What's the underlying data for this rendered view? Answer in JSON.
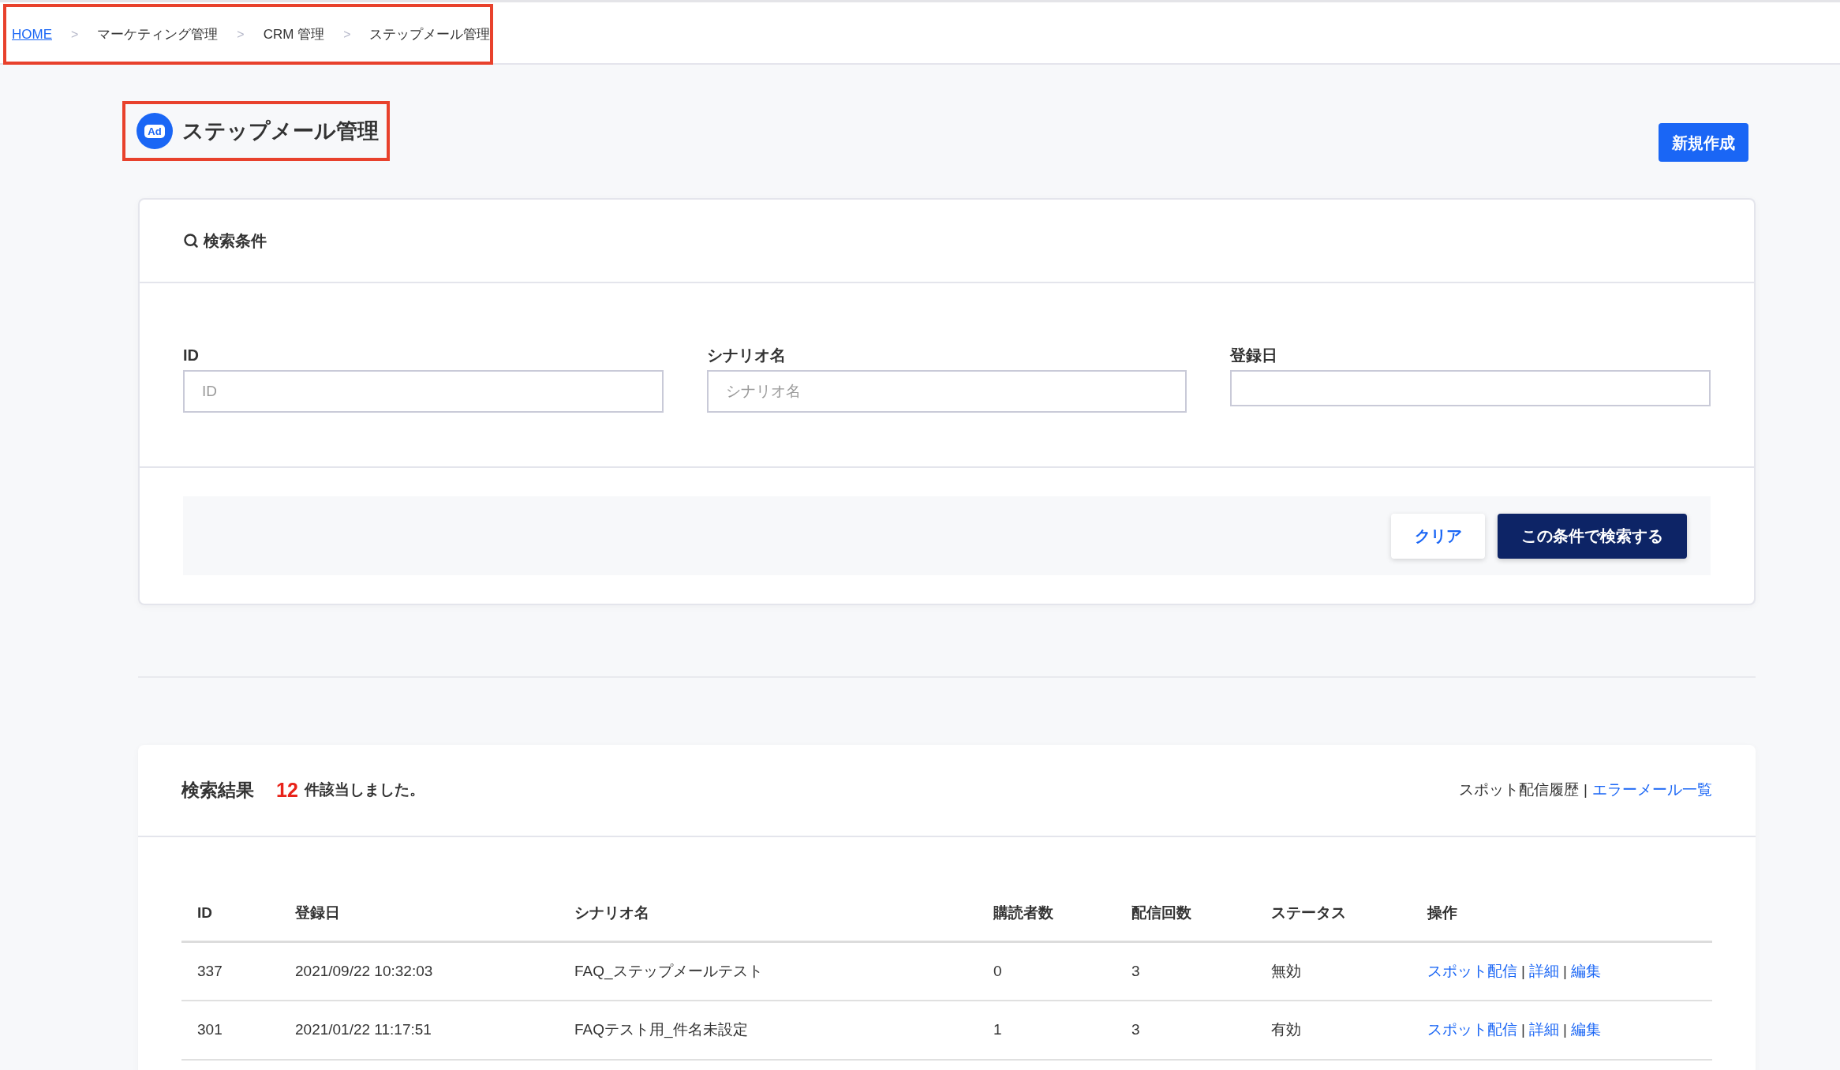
{
  "breadcrumb": {
    "highlighted": true,
    "items": [
      {
        "label": "HOME",
        "kind": "link"
      },
      {
        "separator": ">",
        "label": "マーケティング管理",
        "kind": "text"
      },
      {
        "separator": ">",
        "label": "CRM 管理",
        "kind": "text"
      },
      {
        "separator": ">",
        "label": "ステップメール管理",
        "kind": "text"
      }
    ]
  },
  "page_header": {
    "highlighted": true,
    "logo_text": "Ad",
    "title": "ステップメール管理",
    "new_button": "新規作成"
  },
  "search_panel": {
    "title": "検索条件",
    "fields": [
      {
        "label": "ID",
        "kind": "text",
        "placeholder": "ID"
      },
      {
        "label": "シナリオ名",
        "kind": "text",
        "placeholder": "シナリオ名"
      },
      {
        "label": "登録日",
        "kind": "date"
      }
    ],
    "buttons": [
      {
        "label": "クリア",
        "kind": "secondary"
      },
      {
        "label": "この条件で検索する",
        "kind": "primary"
      }
    ]
  },
  "results": {
    "title": "検索結果",
    "count": "12",
    "count_text": "件該当しました。",
    "links": [
      {
        "label": "スポット配信履歴",
        "kind": "text"
      },
      {
        "separator": "|",
        "label": "エラーメール一覧",
        "kind": "link"
      }
    ],
    "table": {
      "columns": [
        "ID",
        "登録日",
        "シナリオ名",
        "購読者数",
        "配信回数",
        "ステータス",
        "操作"
      ],
      "rows": [
        {
          "cells": [
            "337",
            "2021/09/22 10:32:03",
            "FAQ_ステップメールテスト",
            "0",
            "3",
            "無効"
          ],
          "actions": [
            {
              "label": "スポット配信"
            },
            {
              "separator": "|",
              "label": "詳細"
            },
            {
              "separator": "|",
              "label": "編集"
            }
          ]
        },
        {
          "cells": [
            "301",
            "2021/01/22 11:17:51",
            "FAQテスト用_件名未設定",
            "1",
            "3",
            "有効"
          ],
          "actions": [
            {
              "label": "スポット配信"
            },
            {
              "separator": "|",
              "label": "詳細"
            },
            {
              "separator": "|",
              "label": "編集"
            }
          ]
        }
      ]
    }
  }
}
